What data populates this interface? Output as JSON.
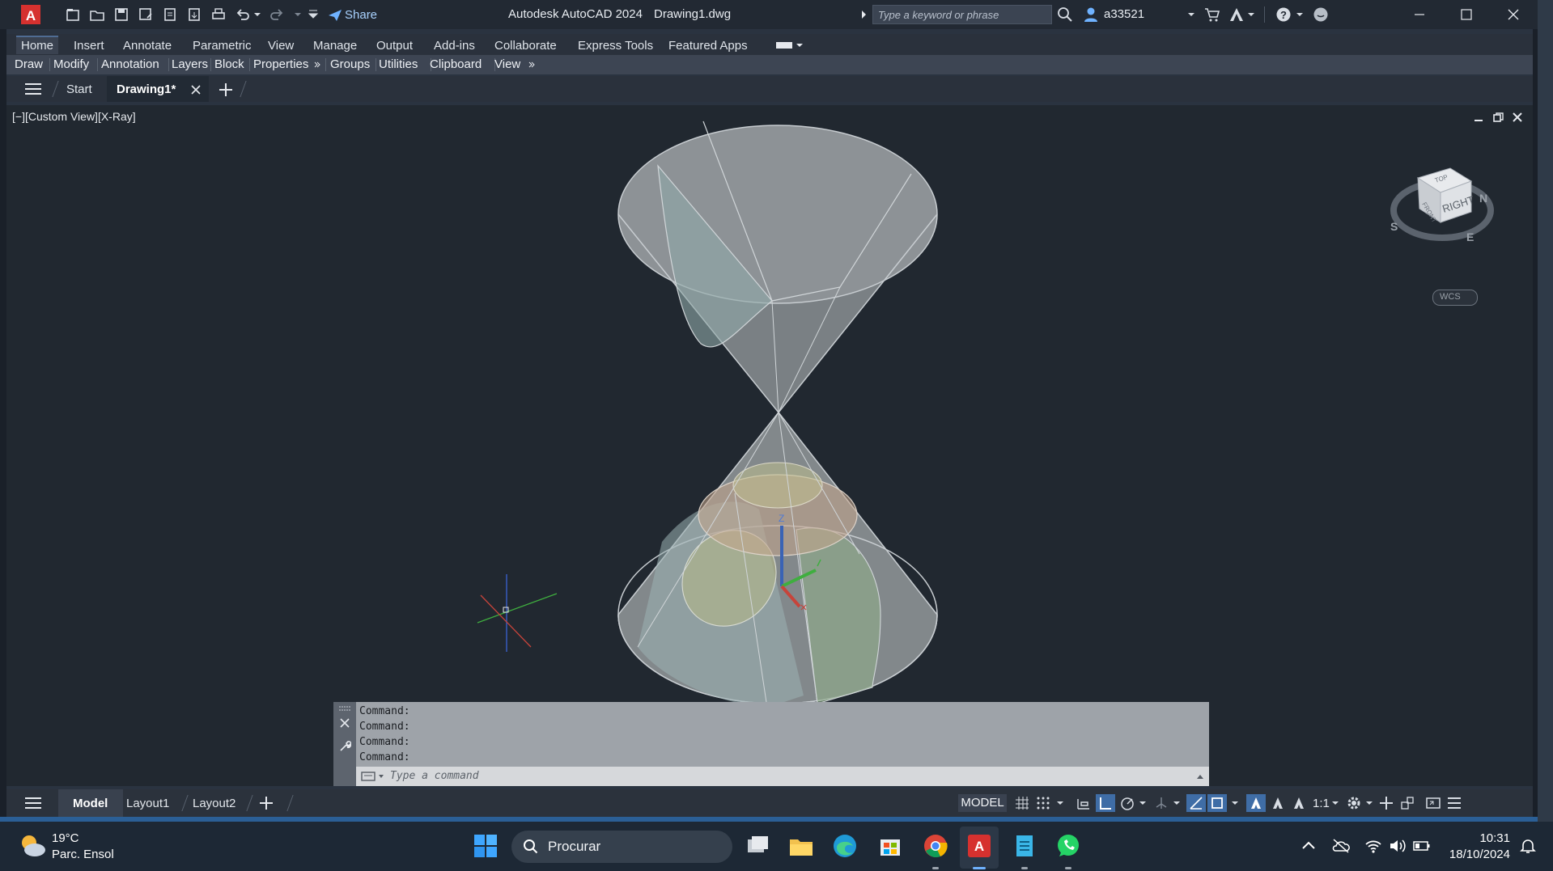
{
  "titlebar": {
    "app_title": "Autodesk AutoCAD 2024",
    "file_name": "Drawing1.dwg",
    "share_label": "Share",
    "search_placeholder": "Type a keyword or phrase",
    "user_name": "a33521"
  },
  "ribbon": {
    "tabs": [
      "Home",
      "Insert",
      "Annotate",
      "Parametric",
      "View",
      "Manage",
      "Output",
      "Add-ins",
      "Collaborate",
      "Express Tools",
      "Featured Apps"
    ],
    "active_tab": "Home",
    "panels": [
      "Draw",
      "Modify",
      "Annotation",
      "Layers",
      "Block",
      "Properties",
      "Groups",
      "Utilities",
      "Clipboard",
      "View"
    ]
  },
  "file_tabs": {
    "start": "Start",
    "active": "Drawing1*"
  },
  "viewport": {
    "label": "[−][Custom View][X-Ray]",
    "viewcube": {
      "face": "RIGHT",
      "top": "TOP",
      "front": "FRONT",
      "n": "N",
      "s": "S",
      "e": "E",
      "wcs": "WCS"
    }
  },
  "command_line": {
    "history": [
      "Command:",
      "Command:",
      "Command:",
      "Command:"
    ],
    "placeholder": "Type a command"
  },
  "statusbar": {
    "layout_tabs": [
      "Model",
      "Layout1",
      "Layout2"
    ],
    "active_layout": "Model",
    "model_label": "MODEL",
    "scale": "1:1"
  },
  "taskbar": {
    "weather_temp": "19°C",
    "weather_desc": "Parc. Ensol",
    "search_label": "Procurar",
    "time": "10:31",
    "date": "18/10/2024"
  },
  "colors": {
    "accent_blue": "#3f6da6",
    "autocad_red": "#d6312f",
    "viewport_bg": "#212830"
  }
}
